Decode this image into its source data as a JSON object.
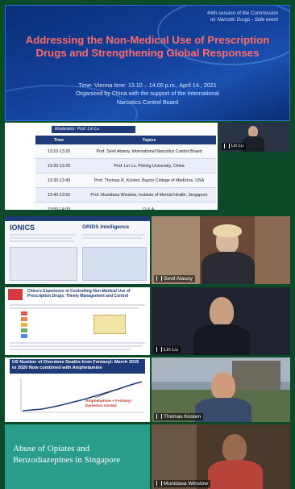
{
  "banner": {
    "session_line1": "64th session of the Commission",
    "session_line2": "on Narcotic Drugs - Side event",
    "headline": "Addressing the Non-Medical Use of Prescription Drugs and Strengthening Global Responses",
    "time": "Time: Vienna time: 13.10 – 14.00 p.m., April 14., 2021",
    "organizer_line1": "Organized by China with the support of the International",
    "organizer_line2": "Narcotics Control Board"
  },
  "program": {
    "moderator": "Moderator: Prof. Lin Lu",
    "col_time": "Time",
    "col_topics": "Topics",
    "rows": [
      {
        "time": "13:10-13:20",
        "topic": "Prof. Sevil Atasoy, International Narcotics Control Board"
      },
      {
        "time": "13:20-13:30",
        "topic": "Prof. Lin Lu, Peking University, China"
      },
      {
        "time": "13:30-13:40",
        "topic": "Prof. Thomas R. Kosten,  Baylor College of Medicine, USA"
      },
      {
        "time": "13:40-13:50",
        "topic": "Prof. Munidasa Winslow, Institute of Mental Health, Singapore"
      },
      {
        "time": "13:50-14:00",
        "topic": "Q & A."
      }
    ]
  },
  "participants": {
    "small": "Lin Lu",
    "sevil": "Sevil Atasoy",
    "lin": "Lin Lu",
    "thomas": "Thomas Kosten",
    "munidasa": "Munidasa Winslow"
  },
  "slides": {
    "ionics_title": "IONICS",
    "grids_title": "GRIDS Intelligence",
    "china_title": "China's Experience in Controlling Non-Medical Use of Prescription Drugs: Timely Management and Control",
    "overdose_title": "US Number of Overdose Deaths from Fentanyl: March 2015 to 2020 Now combined with Amphetamine",
    "overdose_label1": "Amphetamine + Fentanyl",
    "overdose_label2": "Epidemic started",
    "abuse_title": "Abuse of Opiates and Benzodiazepines in Singapore"
  },
  "colors": {
    "banner_headline": "#ff6b6b",
    "slide_navy": "#1e3a78",
    "abuse_bg": "#2a9d8a",
    "page_bg": "#0d4a2a"
  }
}
